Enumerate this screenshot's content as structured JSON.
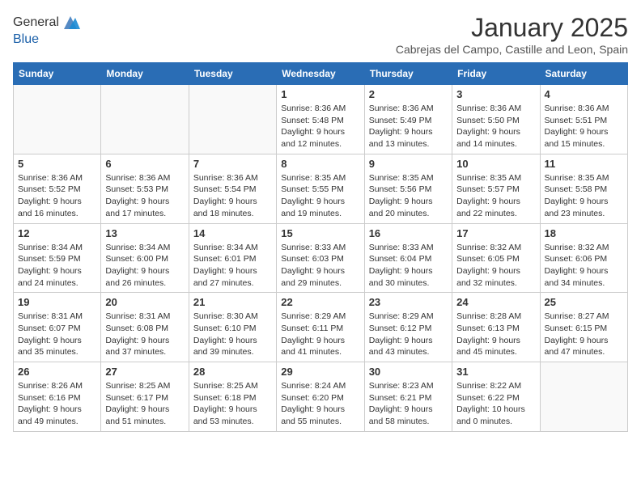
{
  "header": {
    "logo_line1": "General",
    "logo_line2": "Blue",
    "month_title": "January 2025",
    "subtitle": "Cabrejas del Campo, Castille and Leon, Spain"
  },
  "weekdays": [
    "Sunday",
    "Monday",
    "Tuesday",
    "Wednesday",
    "Thursday",
    "Friday",
    "Saturday"
  ],
  "weeks": [
    [
      {
        "day": "",
        "info": ""
      },
      {
        "day": "",
        "info": ""
      },
      {
        "day": "",
        "info": ""
      },
      {
        "day": "1",
        "info": "Sunrise: 8:36 AM\nSunset: 5:48 PM\nDaylight: 9 hours and 12 minutes."
      },
      {
        "day": "2",
        "info": "Sunrise: 8:36 AM\nSunset: 5:49 PM\nDaylight: 9 hours and 13 minutes."
      },
      {
        "day": "3",
        "info": "Sunrise: 8:36 AM\nSunset: 5:50 PM\nDaylight: 9 hours and 14 minutes."
      },
      {
        "day": "4",
        "info": "Sunrise: 8:36 AM\nSunset: 5:51 PM\nDaylight: 9 hours and 15 minutes."
      }
    ],
    [
      {
        "day": "5",
        "info": "Sunrise: 8:36 AM\nSunset: 5:52 PM\nDaylight: 9 hours and 16 minutes."
      },
      {
        "day": "6",
        "info": "Sunrise: 8:36 AM\nSunset: 5:53 PM\nDaylight: 9 hours and 17 minutes."
      },
      {
        "day": "7",
        "info": "Sunrise: 8:36 AM\nSunset: 5:54 PM\nDaylight: 9 hours and 18 minutes."
      },
      {
        "day": "8",
        "info": "Sunrise: 8:35 AM\nSunset: 5:55 PM\nDaylight: 9 hours and 19 minutes."
      },
      {
        "day": "9",
        "info": "Sunrise: 8:35 AM\nSunset: 5:56 PM\nDaylight: 9 hours and 20 minutes."
      },
      {
        "day": "10",
        "info": "Sunrise: 8:35 AM\nSunset: 5:57 PM\nDaylight: 9 hours and 22 minutes."
      },
      {
        "day": "11",
        "info": "Sunrise: 8:35 AM\nSunset: 5:58 PM\nDaylight: 9 hours and 23 minutes."
      }
    ],
    [
      {
        "day": "12",
        "info": "Sunrise: 8:34 AM\nSunset: 5:59 PM\nDaylight: 9 hours and 24 minutes."
      },
      {
        "day": "13",
        "info": "Sunrise: 8:34 AM\nSunset: 6:00 PM\nDaylight: 9 hours and 26 minutes."
      },
      {
        "day": "14",
        "info": "Sunrise: 8:34 AM\nSunset: 6:01 PM\nDaylight: 9 hours and 27 minutes."
      },
      {
        "day": "15",
        "info": "Sunrise: 8:33 AM\nSunset: 6:03 PM\nDaylight: 9 hours and 29 minutes."
      },
      {
        "day": "16",
        "info": "Sunrise: 8:33 AM\nSunset: 6:04 PM\nDaylight: 9 hours and 30 minutes."
      },
      {
        "day": "17",
        "info": "Sunrise: 8:32 AM\nSunset: 6:05 PM\nDaylight: 9 hours and 32 minutes."
      },
      {
        "day": "18",
        "info": "Sunrise: 8:32 AM\nSunset: 6:06 PM\nDaylight: 9 hours and 34 minutes."
      }
    ],
    [
      {
        "day": "19",
        "info": "Sunrise: 8:31 AM\nSunset: 6:07 PM\nDaylight: 9 hours and 35 minutes."
      },
      {
        "day": "20",
        "info": "Sunrise: 8:31 AM\nSunset: 6:08 PM\nDaylight: 9 hours and 37 minutes."
      },
      {
        "day": "21",
        "info": "Sunrise: 8:30 AM\nSunset: 6:10 PM\nDaylight: 9 hours and 39 minutes."
      },
      {
        "day": "22",
        "info": "Sunrise: 8:29 AM\nSunset: 6:11 PM\nDaylight: 9 hours and 41 minutes."
      },
      {
        "day": "23",
        "info": "Sunrise: 8:29 AM\nSunset: 6:12 PM\nDaylight: 9 hours and 43 minutes."
      },
      {
        "day": "24",
        "info": "Sunrise: 8:28 AM\nSunset: 6:13 PM\nDaylight: 9 hours and 45 minutes."
      },
      {
        "day": "25",
        "info": "Sunrise: 8:27 AM\nSunset: 6:15 PM\nDaylight: 9 hours and 47 minutes."
      }
    ],
    [
      {
        "day": "26",
        "info": "Sunrise: 8:26 AM\nSunset: 6:16 PM\nDaylight: 9 hours and 49 minutes."
      },
      {
        "day": "27",
        "info": "Sunrise: 8:25 AM\nSunset: 6:17 PM\nDaylight: 9 hours and 51 minutes."
      },
      {
        "day": "28",
        "info": "Sunrise: 8:25 AM\nSunset: 6:18 PM\nDaylight: 9 hours and 53 minutes."
      },
      {
        "day": "29",
        "info": "Sunrise: 8:24 AM\nSunset: 6:20 PM\nDaylight: 9 hours and 55 minutes."
      },
      {
        "day": "30",
        "info": "Sunrise: 8:23 AM\nSunset: 6:21 PM\nDaylight: 9 hours and 58 minutes."
      },
      {
        "day": "31",
        "info": "Sunrise: 8:22 AM\nSunset: 6:22 PM\nDaylight: 10 hours and 0 minutes."
      },
      {
        "day": "",
        "info": ""
      }
    ]
  ]
}
